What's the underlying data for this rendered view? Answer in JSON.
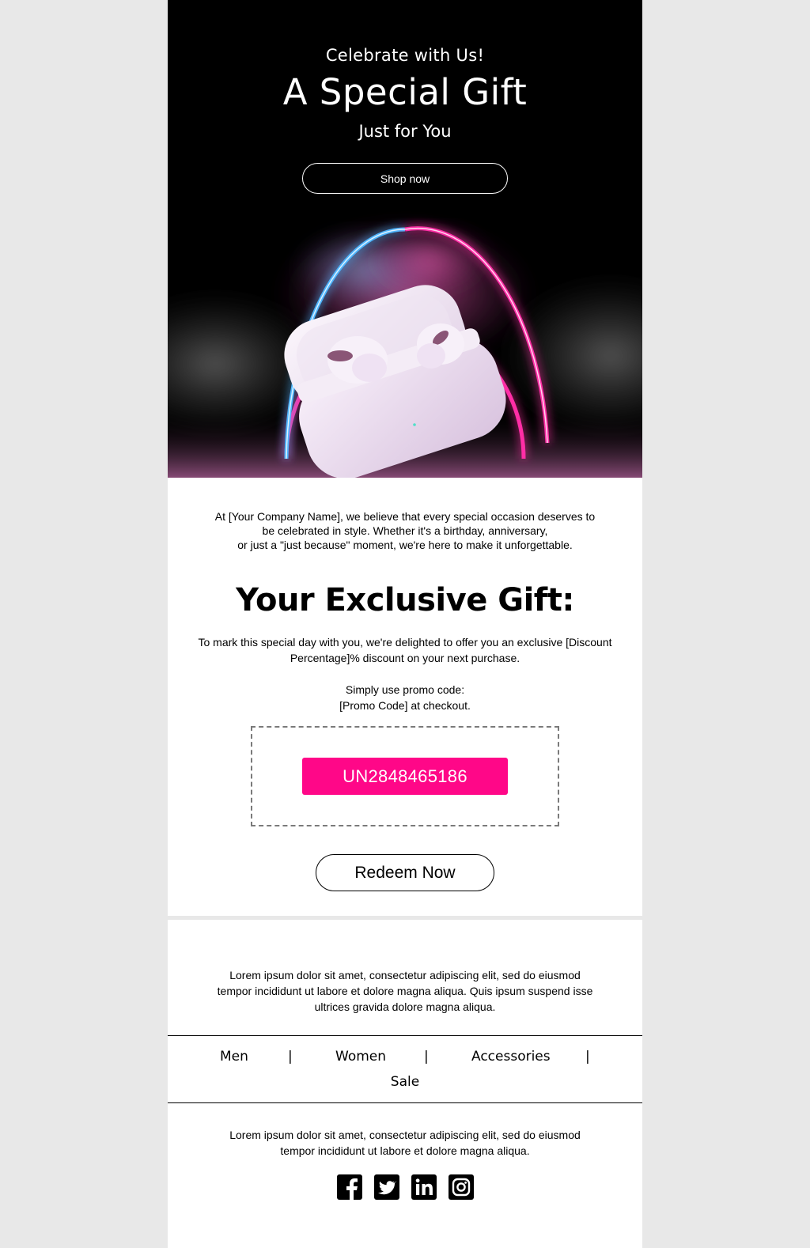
{
  "hero": {
    "subtitle": "Celebrate with Us!",
    "title": "A Special Gift",
    "tagline": "Just for You",
    "shop_button": "Shop now"
  },
  "intro": {
    "line1": "At [Your Company Name], we believe that every special occasion deserves to",
    "line2": "be celebrated in style. Whether it's a birthday, anniversary,",
    "line3": "or just a \"just because\" moment, we're here to make it unforgettable."
  },
  "gift": {
    "title": "Your Exclusive Gift:",
    "line1": "To mark this special day with you, we're delighted to offer you an exclusive [Discount",
    "line2": "Percentage]% discount on your next purchase.",
    "promo_line1": "Simply use promo code:",
    "promo_line2": "[Promo Code] at checkout.",
    "code": "UN2848465186",
    "redeem_button": "Redeem Now"
  },
  "footer": {
    "lorem1_line1": "Lorem ipsum dolor sit amet, consectetur adipiscing elit, sed do eiusmod",
    "lorem1_line2": "tempor incididunt ut labore et dolore magna aliqua. Quis ipsum suspend isse",
    "lorem1_line3": "ultrices gravida dolore magna aliqua.",
    "nav": {
      "men": "Men",
      "women": "Women",
      "accessories": "Accessories",
      "sale": "Sale",
      "separator": "|"
    },
    "lorem2_line1": "Lorem ipsum dolor sit amet, consectetur adipiscing elit, sed do eiusmod",
    "lorem2_line2": "tempor incididunt ut labore et dolore magna aliqua.",
    "social_icons": [
      "facebook-icon",
      "twitter-icon",
      "linkedin-icon",
      "instagram-icon"
    ]
  },
  "colors": {
    "page_bg": "#e8e8e8",
    "hero_bg": "#000000",
    "accent_pink": "#ff0788",
    "neon_blue": "#4fb6ff"
  }
}
